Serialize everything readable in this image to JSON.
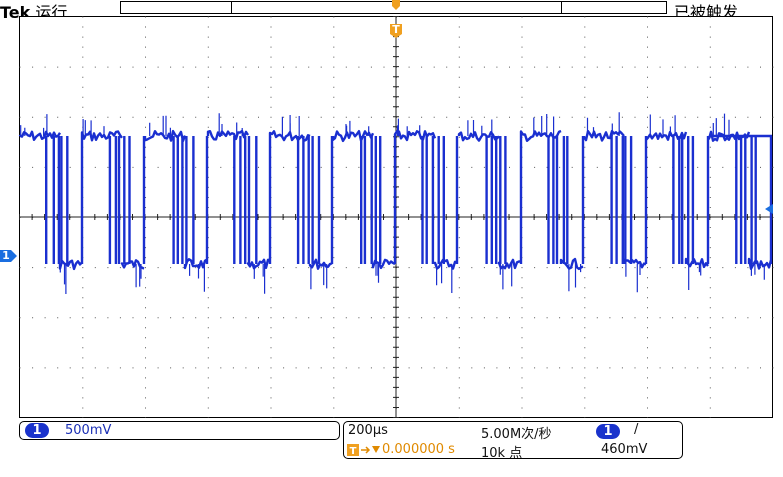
{
  "header": {
    "brand": "Tek",
    "run_state": "运行",
    "trigger_status": "已被触发"
  },
  "markers": {
    "trigger_position": "T",
    "channel_ground": "1"
  },
  "channel": {
    "number": "1",
    "scale": "500mV"
  },
  "timebase": {
    "scale": "200μs",
    "sample_rate": "5.00M次/秒",
    "trigger_offset": "0.000000 s",
    "record_length": "10k 点",
    "trigger_source": "1",
    "trigger_slope": "/",
    "trigger_level": "460mV"
  },
  "colors": {
    "trace": "#1a2fd0",
    "trigger_marker": "#f0a020",
    "channel_marker": "#1a6ee0",
    "grid": "#000000"
  }
}
